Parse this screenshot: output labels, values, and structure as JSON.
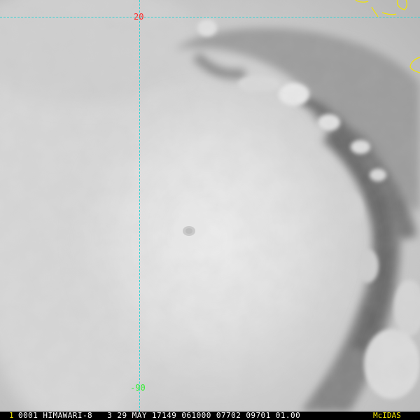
{
  "image": {
    "subject": "Himawari-8 visible satellite image of a tropical cyclone with a visible eye",
    "colors": {
      "gridline": "#35d4d4",
      "coastline": "#f2e500",
      "lat_label": "#ff2a2a",
      "lon_label": "#33ee33",
      "info_text": "#ffffff",
      "info_accent": "#f2e500"
    }
  },
  "grid": {
    "lat_label": "20",
    "lon_label": "-90"
  },
  "info_bar": {
    "frame_number": "1",
    "text": "0001 HIMAWARI-8   3 29 MAY 17149 061000 07702 09701 01.00",
    "brand": "McIDAS"
  }
}
